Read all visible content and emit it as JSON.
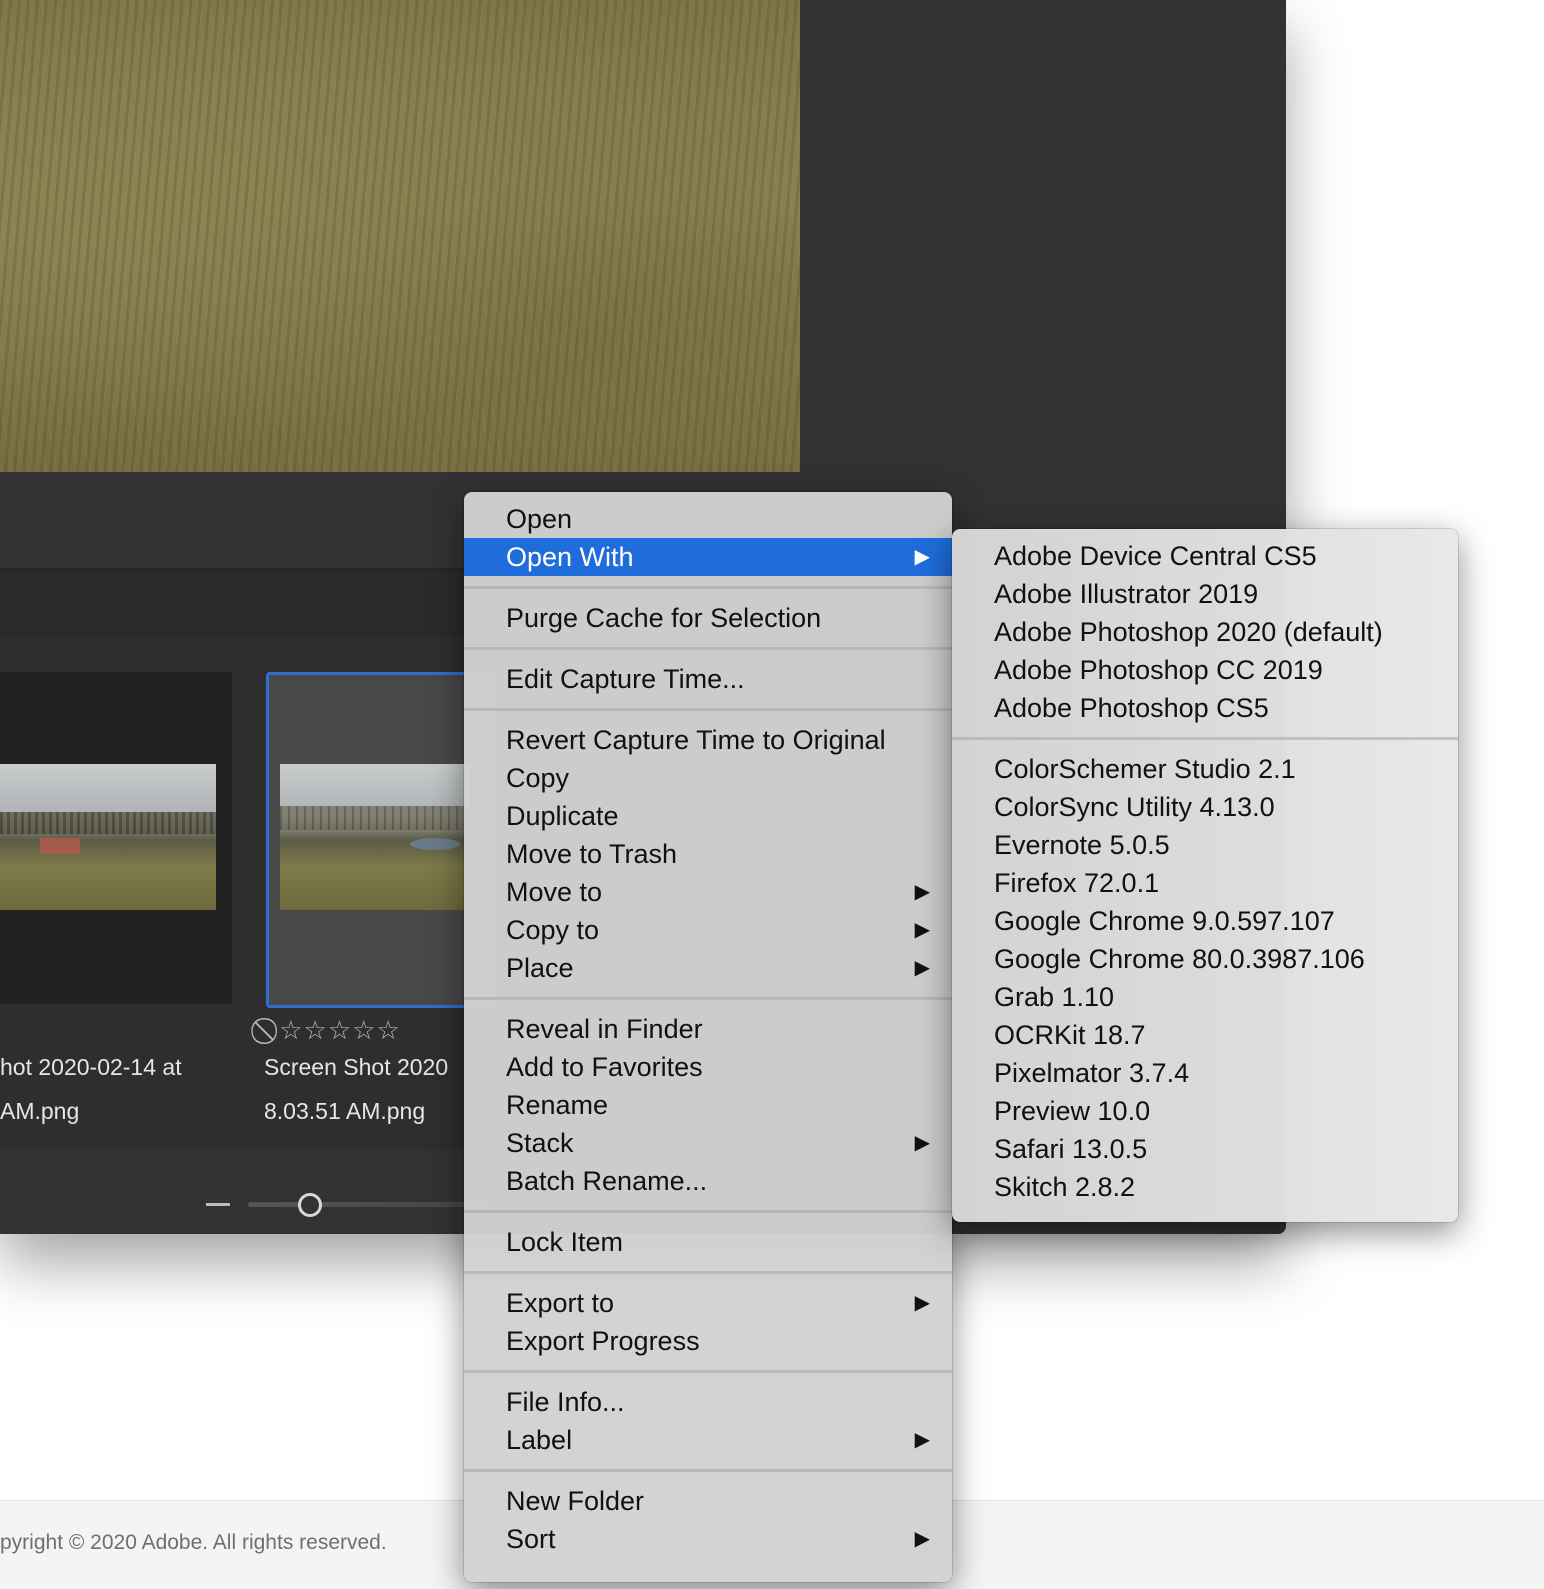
{
  "thumbnails": {
    "items": [
      {
        "filename_line1": "hot 2020-02-14 at",
        "filename_line2": "AM.png"
      },
      {
        "filename_line1": "Screen Shot 2020",
        "filename_line2": "8.03.51 AM.png"
      }
    ],
    "rating": {
      "reject_icon": "⃠",
      "stars": "☆☆☆☆☆",
      "value": 0
    }
  },
  "footer": {
    "copyright": "pyright © 2020 Adobe. All rights reserved."
  },
  "context_menu": {
    "groups": [
      [
        {
          "label": "Open"
        },
        {
          "label": "Open With",
          "submenu": true,
          "selected": true
        }
      ],
      [
        {
          "label": "Purge Cache for Selection"
        }
      ],
      [
        {
          "label": "Edit Capture Time..."
        }
      ],
      [
        {
          "label": "Revert Capture Time to Original"
        },
        {
          "label": "Copy"
        },
        {
          "label": "Duplicate"
        },
        {
          "label": "Move to Trash"
        },
        {
          "label": "Move to",
          "submenu": true
        },
        {
          "label": "Copy to",
          "submenu": true
        },
        {
          "label": "Place",
          "submenu": true
        }
      ],
      [
        {
          "label": "Reveal in Finder"
        },
        {
          "label": "Add to Favorites"
        },
        {
          "label": "Rename"
        },
        {
          "label": "Stack",
          "submenu": true
        },
        {
          "label": "Batch Rename..."
        }
      ],
      [
        {
          "label": "Lock Item"
        }
      ],
      [
        {
          "label": "Export to",
          "submenu": true
        },
        {
          "label": "Export Progress"
        }
      ],
      [
        {
          "label": "File Info..."
        },
        {
          "label": "Label",
          "submenu": true
        }
      ],
      [
        {
          "label": "New Folder"
        },
        {
          "label": "Sort",
          "submenu": true
        }
      ]
    ],
    "submenu_arrow": "▶"
  },
  "open_with_submenu": {
    "groups": [
      [
        "Adobe Device Central CS5",
        "Adobe Illustrator 2019",
        "Adobe Photoshop 2020 (default)",
        "Adobe Photoshop CC 2019",
        "Adobe Photoshop CS5"
      ],
      [
        "ColorSchemer Studio 2.1",
        "ColorSync Utility 4.13.0",
        "Evernote 5.0.5",
        "Firefox 72.0.1",
        "Google Chrome 9.0.597.107",
        "Google Chrome 80.0.3987.106",
        "Grab 1.10",
        "OCRKit 18.7",
        "Pixelmator 3.7.4",
        "Preview 10.0",
        "Safari 13.0.5",
        "Skitch 2.8.2"
      ]
    ]
  },
  "colors": {
    "selection": "#1f6ddb",
    "window_bg": "#323232",
    "thumb_selected_border": "#2f6fd0"
  }
}
